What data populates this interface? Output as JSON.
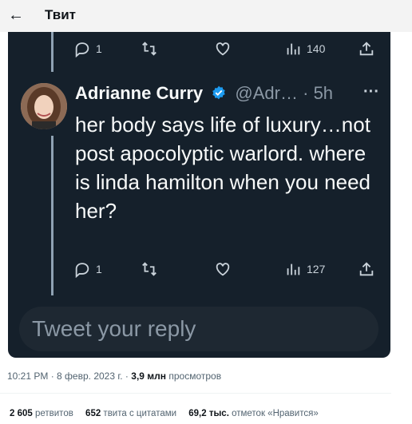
{
  "header": {
    "back_icon": "←",
    "title": "Твит"
  },
  "top_actions": {
    "replies": "1",
    "views": "140"
  },
  "reply_tweet": {
    "name": "Adrianne Curry",
    "handle": "@Adr…",
    "separator": "·",
    "time": "5h",
    "more": "···",
    "text": "her body says life of luxury…not post apocolyptic warlord. where is linda hamilton when you need her?",
    "replies": "1",
    "views": "127"
  },
  "reply_box": {
    "placeholder": "Tweet your reply"
  },
  "meta": {
    "time": "10:21 PM",
    "sep1": " · ",
    "date": "8 февр. 2023 г.",
    "sep2": " · ",
    "views_count": "3,9 млн",
    "views_label": " просмотров"
  },
  "stats": {
    "retweets_count": "2 605",
    "retweets_label": " ретвитов",
    "quotes_count": "652",
    "quotes_label": " твита с цитатами",
    "likes_count": "69,2 тыс.",
    "likes_label": " отметок «Нравится»"
  },
  "colors": {
    "dark_bg": "#15202b",
    "accent": "#1d9bf0"
  }
}
